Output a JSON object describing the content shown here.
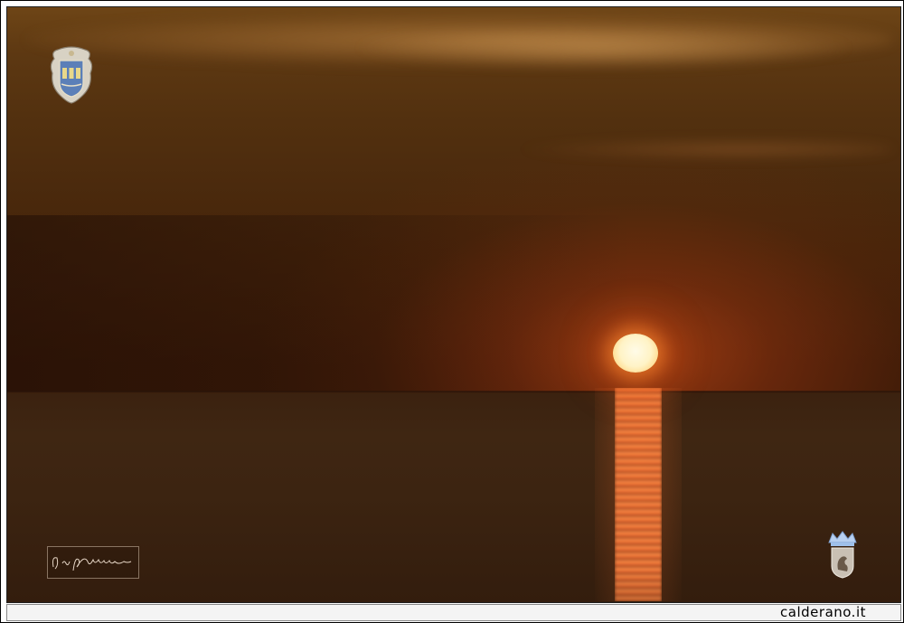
{
  "photo": {
    "subject": "sunset-over-sea",
    "colors": {
      "sky_top": "#6e4516",
      "sky_mid": "#452309",
      "sea": "#3d2411",
      "sun": "#fff3c6",
      "reflection": "#ff8c46"
    }
  },
  "overlays": {
    "coat_of_arms_icon": "coat-of-arms-icon",
    "signature_icon": "handwritten-signature-icon",
    "crown_logo_icon": "crown-crest-icon"
  },
  "footer": {
    "site_label": "calderano.it"
  }
}
